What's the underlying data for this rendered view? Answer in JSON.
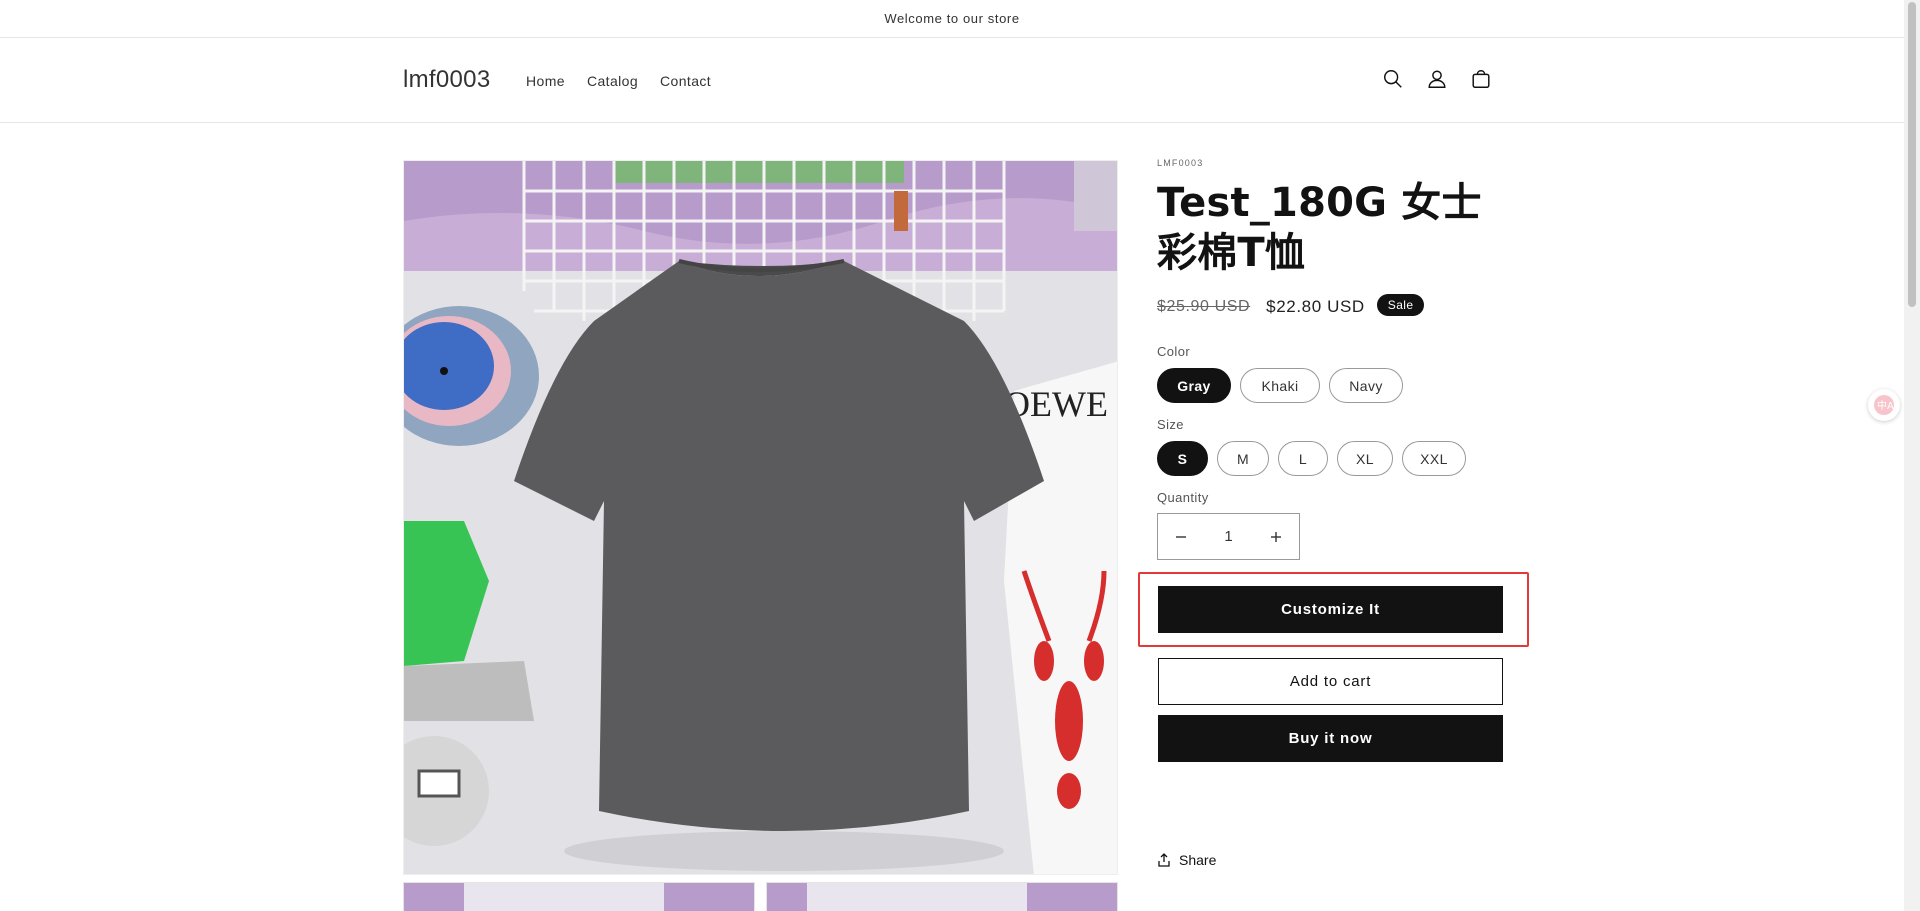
{
  "announcement": "Welcome to our store",
  "header": {
    "logo": "lmf0003",
    "nav": [
      "Home",
      "Catalog",
      "Contact"
    ],
    "icons": [
      "search-icon",
      "account-icon",
      "cart-icon"
    ]
  },
  "product": {
    "vendor": "LMF0003",
    "title": "Test_180G 女士彩棉T恤",
    "price_compare": "$25.90 USD",
    "price_sale": "$22.80 USD",
    "badge": "Sale",
    "color_label": "Color",
    "colors": [
      "Gray",
      "Khaki",
      "Navy"
    ],
    "color_selected": "Gray",
    "size_label": "Size",
    "sizes": [
      "S",
      "M",
      "L",
      "XL",
      "XXL"
    ],
    "size_selected": "S",
    "quantity_label": "Quantity",
    "quantity": "1",
    "customize_button": "Customize It",
    "add_to_cart_button": "Add to cart",
    "buy_now_button": "Buy it now",
    "share_label": "Share"
  },
  "colors": {
    "accent": "#121212",
    "highlight_box": "#e23a3a"
  }
}
